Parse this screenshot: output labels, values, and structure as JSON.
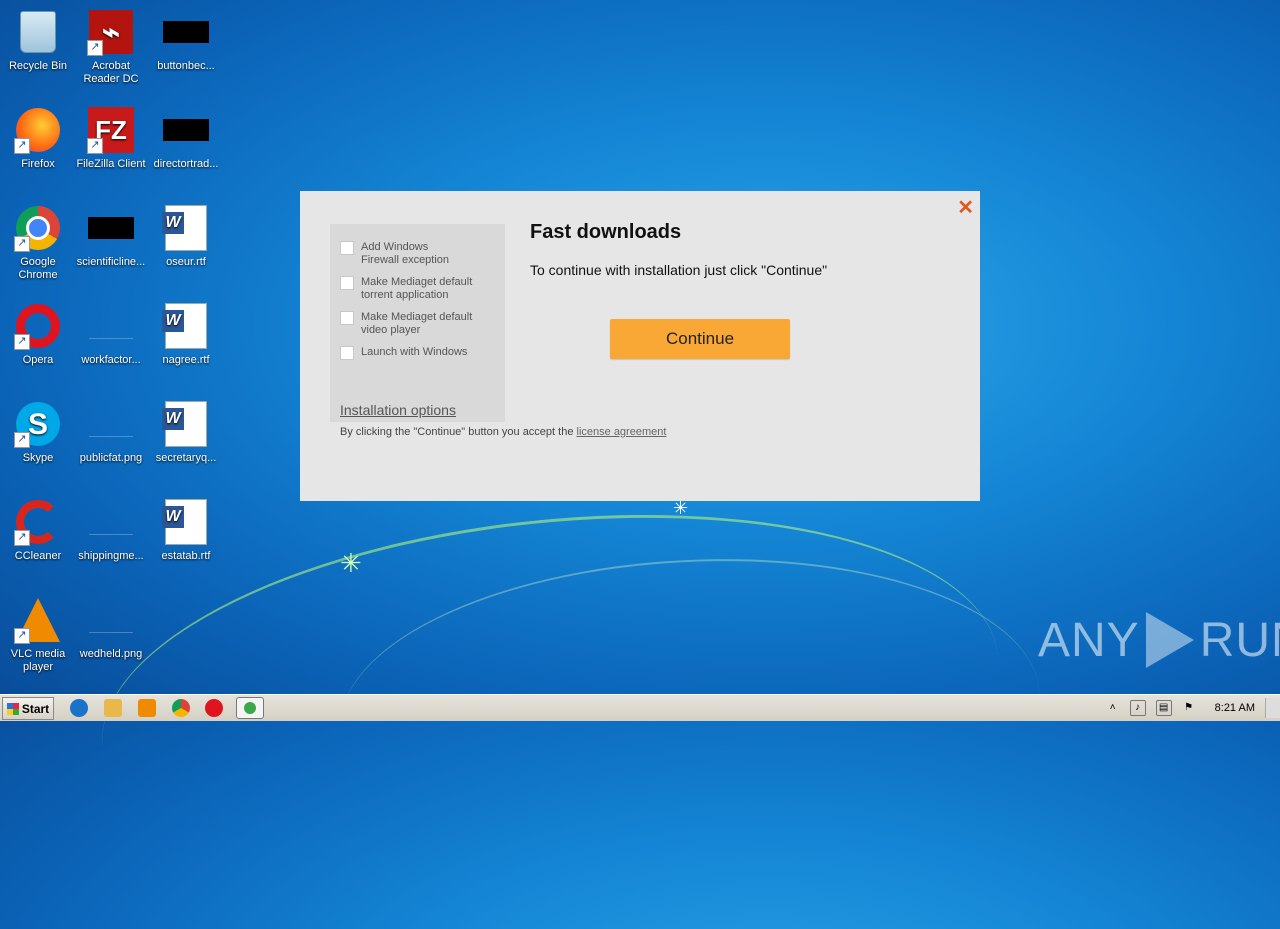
{
  "desktop": {
    "icons": [
      {
        "label": "Recycle Bin"
      },
      {
        "label": "Acrobat Reader DC"
      },
      {
        "label": "buttonbec..."
      },
      {
        "label": "Firefox"
      },
      {
        "label": "FileZilla Client"
      },
      {
        "label": "directortrad..."
      },
      {
        "label": "Google Chrome"
      },
      {
        "label": "scientificline..."
      },
      {
        "label": "oseur.rtf"
      },
      {
        "label": "Opera"
      },
      {
        "label": "workfactor..."
      },
      {
        "label": "nagree.rtf"
      },
      {
        "label": "Skype"
      },
      {
        "label": "publicfat.png"
      },
      {
        "label": "secretaryq..."
      },
      {
        "label": "CCleaner"
      },
      {
        "label": "shippingme..."
      },
      {
        "label": "estatab.rtf"
      },
      {
        "label": "VLC media player"
      },
      {
        "label": "wedheld.png"
      }
    ]
  },
  "dialog": {
    "close_glyph": "✕",
    "options": [
      {
        "label": "Add Windows Firewall exception",
        "checked": false
      },
      {
        "label": "Make Mediaget default torrent application",
        "checked": false
      },
      {
        "label": "Make Mediaget default video player",
        "checked": false
      },
      {
        "label": "Launch with Windows",
        "checked": false
      }
    ],
    "installation_options_label": "Installation options",
    "title": "Fast downloads",
    "subtitle": "To continue with installation just click \"Continue\"",
    "continue_label": "Continue",
    "legal_prefix": "By clicking the \"Continue\" button you accept the ",
    "legal_link": "license agreement"
  },
  "watermark": {
    "left": "ANY",
    "right": "RUN"
  },
  "taskbar": {
    "start_label": "Start",
    "clock": "8:21 AM",
    "colors": {
      "ie": "#1a73c8",
      "explorer": "#e8b84a",
      "media": "#f08a00",
      "chrome": "#db4437",
      "opera": "#e0141e",
      "mediaget": "#3aa84a"
    }
  }
}
